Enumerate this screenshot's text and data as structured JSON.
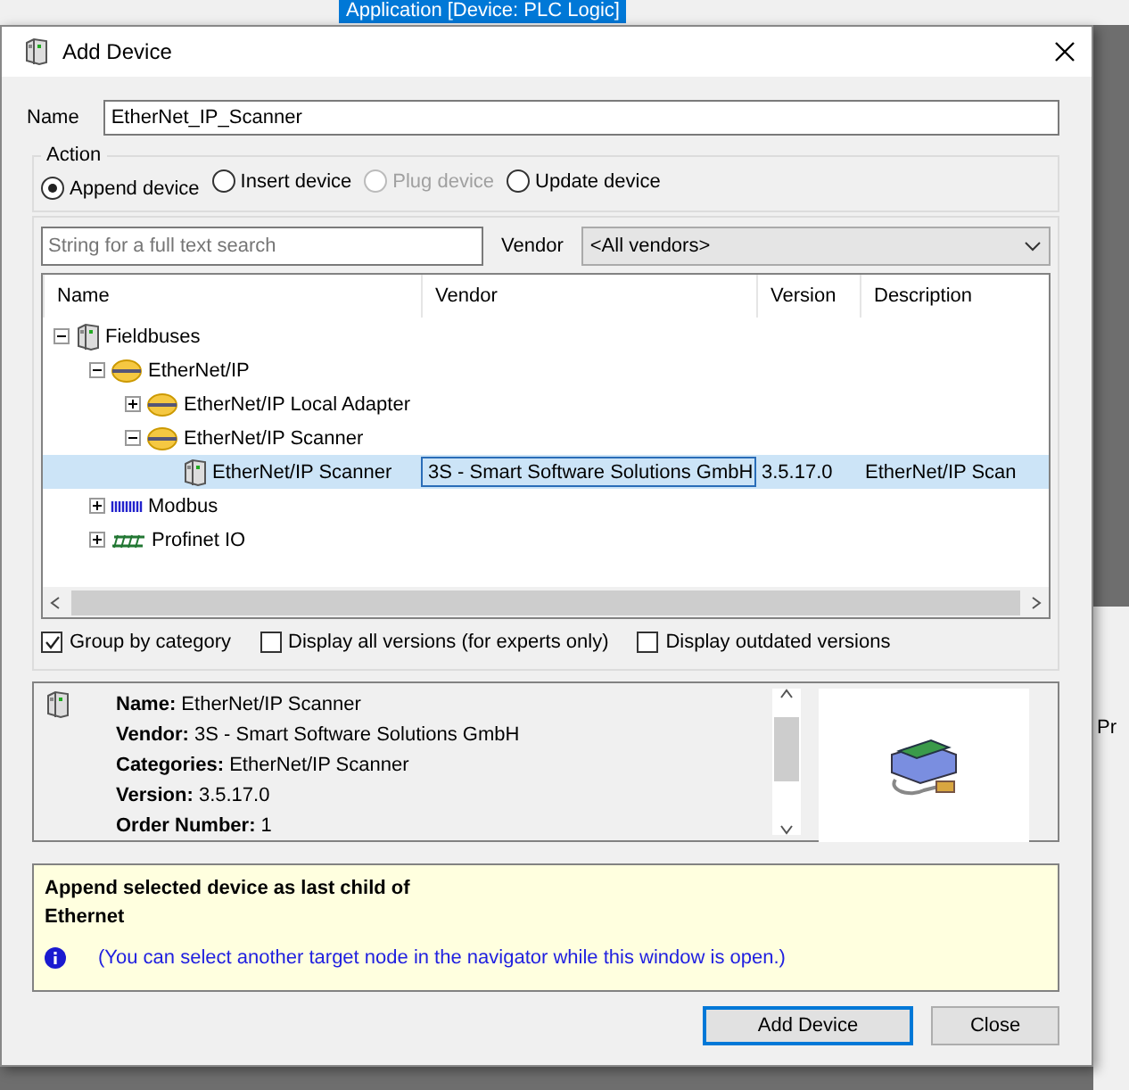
{
  "background_app": {
    "toolbar_field": "Application [Device: PLC Logic]",
    "side_text": "Pr"
  },
  "window": {
    "title": "Add Device"
  },
  "name_field": {
    "label": "Name",
    "value": "EtherNet_IP_Scanner"
  },
  "action": {
    "title": "Action",
    "options": [
      {
        "label": "Append device",
        "selected": true,
        "disabled": false
      },
      {
        "label": "Insert device",
        "selected": false,
        "disabled": false
      },
      {
        "label": "Plug device",
        "selected": false,
        "disabled": true
      },
      {
        "label": "Update device",
        "selected": false,
        "disabled": false
      }
    ]
  },
  "search": {
    "placeholder": "String for a full text search"
  },
  "vendor_filter": {
    "label": "Vendor",
    "value": "<All vendors>"
  },
  "table": {
    "columns": [
      "Name",
      "Vendor",
      "Version",
      "Description"
    ],
    "rows": [
      {
        "name": "Fieldbuses",
        "kind": "device",
        "expanded": true,
        "selected": false,
        "children": [
          {
            "name": "EtherNet/IP",
            "kind": "bus",
            "expanded": true,
            "selected": false,
            "children": [
              {
                "name": "EtherNet/IP Local Adapter",
                "kind": "bus",
                "expanded": false,
                "selected": false
              },
              {
                "name": "EtherNet/IP Scanner",
                "kind": "bus",
                "expanded": true,
                "selected": false,
                "children": [
                  {
                    "name": "EtherNet/IP Scanner",
                    "kind": "device",
                    "selected": true,
                    "vendor": "3S - Smart Software Solutions GmbH",
                    "version": "3.5.17.0",
                    "description": "EtherNet/IP Scan"
                  }
                ]
              }
            ]
          },
          {
            "name": "Modbus",
            "kind": "modbus",
            "expanded": false,
            "selected": false
          },
          {
            "name": "Profinet IO",
            "kind": "profinet",
            "expanded": false,
            "selected": false
          }
        ]
      }
    ]
  },
  "options": [
    {
      "label": "Group by category",
      "checked": true
    },
    {
      "label": "Display all versions (for experts only)",
      "checked": false
    },
    {
      "label": "Display outdated versions",
      "checked": false
    }
  ],
  "details": [
    "**Name:** EtherNet/IP Scanner",
    "**Vendor:** 3S - Smart Software Solutions GmbH",
    "**Categories:** EtherNet/IP Scanner",
    "**Version:** 3.5.17.0",
    "**Order Number:** 1"
  ],
  "message": {
    "lines": [
      "Append selected device as last child of",
      "Ethernet"
    ],
    "note": "(You can select another target node in the navigator while this window is open.)"
  },
  "buttons": [
    {
      "label": "Add Device",
      "default": true
    },
    {
      "label": "Close",
      "default": false
    }
  ]
}
